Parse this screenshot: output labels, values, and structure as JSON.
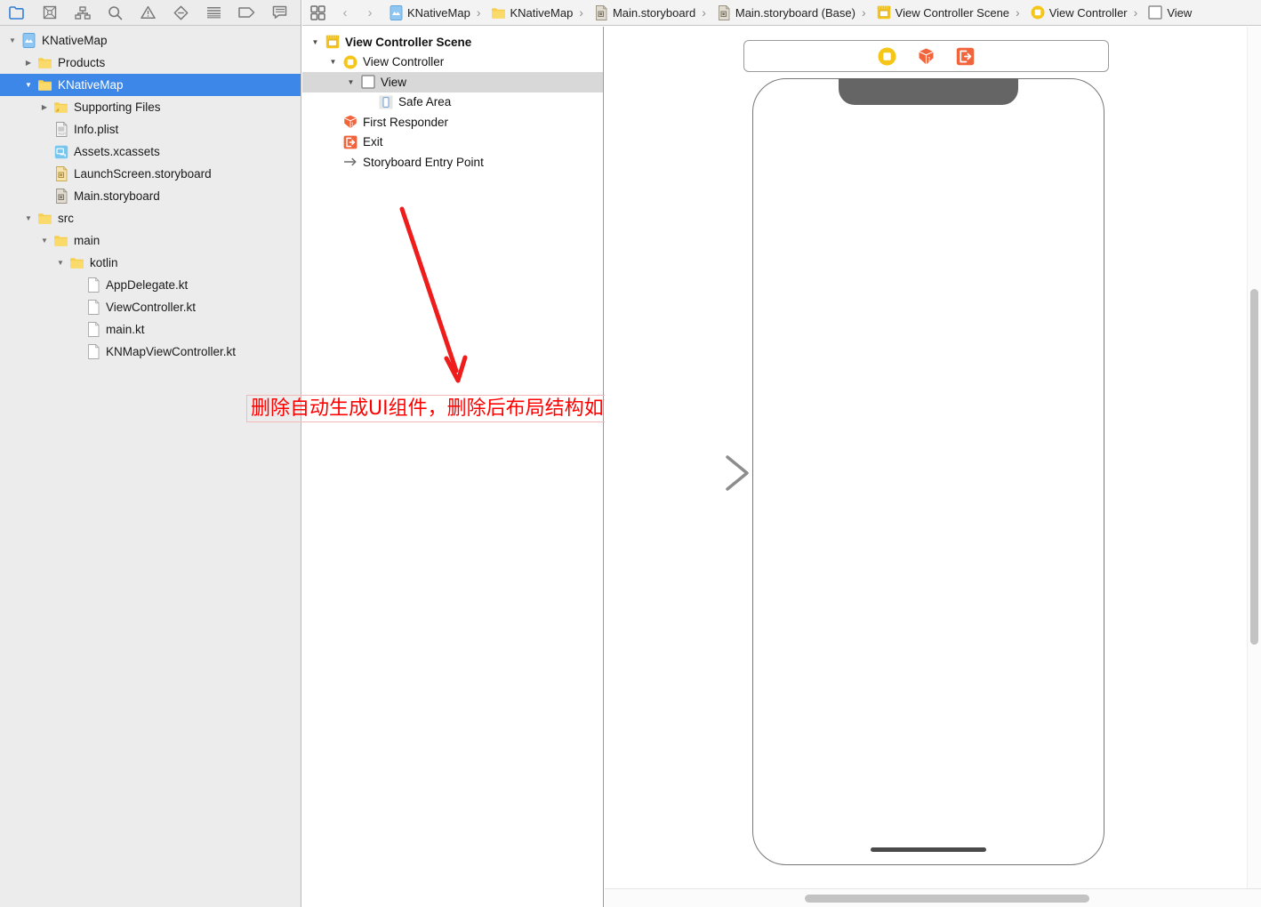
{
  "navigator": {
    "toolbar_icons": [
      {
        "name": "project-navigator-icon",
        "active": true
      },
      {
        "name": "source-control-navigator-icon",
        "active": false
      },
      {
        "name": "symbol-navigator-icon",
        "active": false
      },
      {
        "name": "find-navigator-icon",
        "active": false
      },
      {
        "name": "issue-navigator-icon",
        "active": false
      },
      {
        "name": "test-navigator-icon",
        "active": false
      },
      {
        "name": "debug-navigator-icon",
        "active": false
      },
      {
        "name": "breakpoint-navigator-icon",
        "active": false
      },
      {
        "name": "report-navigator-icon",
        "active": false
      }
    ],
    "tree": [
      {
        "label": "KNativeMap",
        "indent": 0,
        "disc": "open",
        "icon": "xcode-project",
        "selected": false
      },
      {
        "label": "Products",
        "indent": 1,
        "disc": "closed",
        "icon": "folder-yellow",
        "selected": false
      },
      {
        "label": "KNativeMap",
        "indent": 1,
        "disc": "open",
        "icon": "folder-yellow",
        "selected": true
      },
      {
        "label": "Supporting Files",
        "indent": 2,
        "disc": "closed",
        "icon": "folder-group",
        "selected": false
      },
      {
        "label": "Info.plist",
        "indent": 2,
        "disc": "none",
        "icon": "plist-file",
        "selected": false
      },
      {
        "label": "Assets.xcassets",
        "indent": 2,
        "disc": "none",
        "icon": "assets-catalog",
        "selected": false
      },
      {
        "label": "LaunchScreen.storyboard",
        "indent": 2,
        "disc": "none",
        "icon": "storyboard-file",
        "selected": false
      },
      {
        "label": "Main.storyboard",
        "indent": 2,
        "disc": "none",
        "icon": "storyboard-file-gray",
        "selected": false
      },
      {
        "label": "src",
        "indent": 1,
        "disc": "open",
        "icon": "folder-yellow",
        "selected": false
      },
      {
        "label": "main",
        "indent": 2,
        "disc": "open",
        "icon": "folder-yellow",
        "selected": false
      },
      {
        "label": "kotlin",
        "indent": 3,
        "disc": "open",
        "icon": "folder-yellow",
        "selected": false
      },
      {
        "label": "AppDelegate.kt",
        "indent": 4,
        "disc": "none",
        "icon": "generic-file",
        "selected": false
      },
      {
        "label": "ViewController.kt",
        "indent": 4,
        "disc": "none",
        "icon": "generic-file",
        "selected": false
      },
      {
        "label": "main.kt",
        "indent": 4,
        "disc": "none",
        "icon": "generic-file",
        "selected": false
      },
      {
        "label": "KNMapViewController.kt",
        "indent": 4,
        "disc": "none",
        "icon": "generic-file",
        "selected": false
      }
    ]
  },
  "breadcrumb": {
    "back_label": "‹",
    "forward_label": "›",
    "separator": "›",
    "items": [
      {
        "label": "KNativeMap",
        "icon": "xcode-project"
      },
      {
        "label": "KNativeMap",
        "icon": "folder-yellow"
      },
      {
        "label": "Main.storyboard",
        "icon": "storyboard-file-gray"
      },
      {
        "label": "Main.storyboard (Base)",
        "icon": "storyboard-file-gray"
      },
      {
        "label": "View Controller Scene",
        "icon": "scene-icon"
      },
      {
        "label": "View Controller",
        "icon": "view-controller-icon"
      },
      {
        "label": "View",
        "icon": "view-icon"
      }
    ]
  },
  "outline": {
    "rows": [
      {
        "label": "View Controller Scene",
        "indent": 0,
        "disc": "open",
        "icon": "scene-icon",
        "selected": false,
        "bold": true
      },
      {
        "label": "View Controller",
        "indent": 1,
        "disc": "open",
        "icon": "view-controller-icon",
        "selected": false,
        "bold": false
      },
      {
        "label": "View",
        "indent": 2,
        "disc": "open",
        "icon": "view-icon",
        "selected": true,
        "bold": false
      },
      {
        "label": "Safe Area",
        "indent": 3,
        "disc": "none",
        "icon": "safe-area-icon",
        "selected": false,
        "bold": false
      },
      {
        "label": "First Responder",
        "indent": 1,
        "disc": "none",
        "icon": "first-responder-icon",
        "selected": false,
        "bold": false
      },
      {
        "label": "Exit",
        "indent": 1,
        "disc": "none",
        "icon": "exit-icon",
        "selected": false,
        "bold": false
      },
      {
        "label": "Storyboard Entry Point",
        "indent": 1,
        "disc": "none",
        "icon": "entry-point-arrow-icon",
        "selected": false,
        "bold": false
      }
    ]
  },
  "annotation": {
    "text": "删除自动生成UI组件，删除后布局结构如下",
    "box_color": "#ef1c1c",
    "text_color": "#ff0000"
  },
  "canvas": {
    "scene_dock": [
      {
        "name": "view-controller-icon",
        "title": "View Controller"
      },
      {
        "name": "first-responder-icon",
        "title": "First Responder"
      },
      {
        "name": "exit-icon",
        "title": "Exit"
      }
    ],
    "device": "iPhone",
    "entry_point_arrow": "storyboard-entry-point-arrow"
  }
}
